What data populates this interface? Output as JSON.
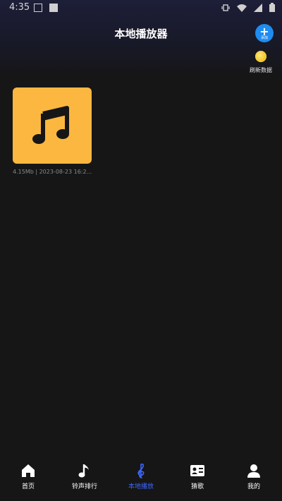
{
  "status_bar": {
    "time": "4:35"
  },
  "header": {
    "title": "本地播放器"
  },
  "add_button": {
    "label": "添加"
  },
  "refresh": {
    "label": "刷新数据"
  },
  "files": [
    {
      "meta": "4.15Mb | 2023-08-23 16:2..."
    }
  ],
  "tabs": [
    {
      "label": "首页",
      "icon": "home-icon"
    },
    {
      "label": "铃声排行",
      "icon": "music-note-icon"
    },
    {
      "label": "本地播放",
      "icon": "treble-clef-icon",
      "active": true
    },
    {
      "label": "猜歌",
      "icon": "id-card-icon"
    },
    {
      "label": "我的",
      "icon": "user-icon"
    }
  ],
  "colors": {
    "accent": "#3c66ff",
    "add_button": "#1e8cf0",
    "card": "#fbb73f"
  }
}
